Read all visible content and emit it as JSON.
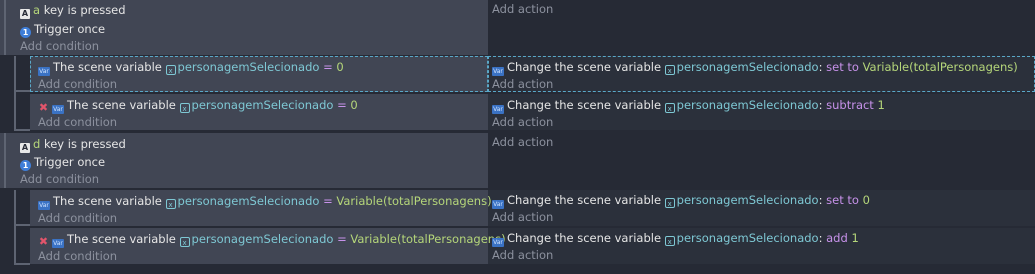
{
  "labels": {
    "add_action": "Add action",
    "add_condition": "Add condition",
    "scene_var": "The scene variable",
    "change_var": "Change the scene variable"
  },
  "icons": {
    "key": "keyboard-key-icon",
    "trigger": "trigger-once-icon",
    "variable": "scene-variable-icon",
    "invert": "inverted-condition-icon",
    "var_ref": "variable-reference-icon"
  },
  "events": [
    {
      "key": "a",
      "key_text": "key is pressed",
      "trigger": "Trigger once"
    },
    {
      "key": "d",
      "key_text": "key is pressed",
      "trigger": "Trigger once"
    }
  ],
  "subevents": [
    {
      "cond_var": "personagemSelecionado",
      "cond_op": "=",
      "cond_val": "0",
      "act_var": "personagemSelecionado",
      "act_op": "set to",
      "act_val": "Variable(totalPersonagens)"
    },
    {
      "cond_var": "personagemSelecionado",
      "cond_op": "=",
      "cond_val": "0",
      "act_var": "personagemSelecionado",
      "act_op": "subtract",
      "act_val": "1"
    },
    {
      "cond_var": "personagemSelecionado",
      "cond_op": "=",
      "cond_val": "Variable(totalPersonagens)",
      "act_var": "personagemSelecionado",
      "act_op": "set to",
      "act_val": "0"
    },
    {
      "cond_var": "personagemSelecionado",
      "cond_op": "=",
      "cond_val": "Variable(totalPersonagens)",
      "act_var": "personagemSelecionado",
      "act_op": "add",
      "act_val": "1"
    }
  ]
}
